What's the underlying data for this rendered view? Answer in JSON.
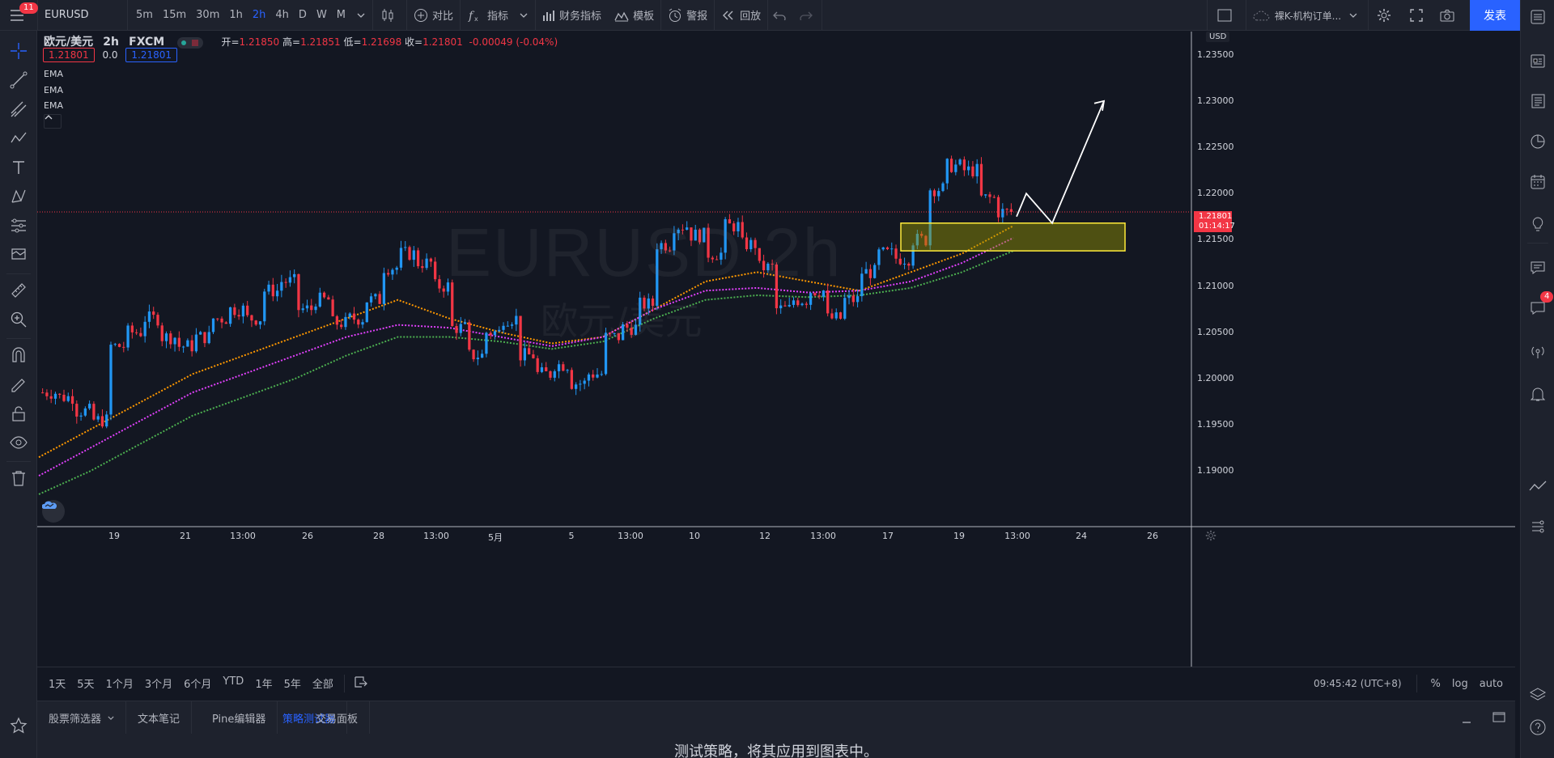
{
  "topbar": {
    "menu_badge": "11",
    "symbol": "EURUSD",
    "timeframes": [
      "5m",
      "15m",
      "30m",
      "1h",
      "2h",
      "4h",
      "D",
      "W",
      "M"
    ],
    "active_timeframe": "2h",
    "compare_label": "对比",
    "indicators_label": "指标",
    "financials_label": "财务指标",
    "templates_label": "模板",
    "alerts_label": "警报",
    "replay_label": "回放",
    "layout_name": "裸K-机构订单...",
    "publish_label": "发表"
  },
  "legend": {
    "title": "欧元/美元",
    "interval": "2h",
    "exchange": "FXCM",
    "open_label": "开=",
    "open": "1.21850",
    "high_label": "高=",
    "high": "1.21851",
    "low_label": "低=",
    "low": "1.21698",
    "close_label": "收=",
    "close": "1.21801",
    "change": "-0.00049 (-0.04%)",
    "bid": "1.21801",
    "spread": "0.0",
    "ask": "1.21801",
    "indicators": [
      "EMA",
      "EMA",
      "EMA"
    ]
  },
  "watermark": {
    "symbol": "EURUSD",
    "interval": "2h",
    "name": "欧元/美元"
  },
  "price_axis": {
    "currency": "USD",
    "ticks": [
      "1.23500",
      "1.23000",
      "1.22500",
      "1.22000",
      "1.21500",
      "1.21000",
      "1.20500",
      "1.20000",
      "1.19500",
      "1.19000"
    ],
    "current_price": "1.21801",
    "countdown": "01:14:17"
  },
  "time_axis": {
    "ticks": [
      "19",
      "21",
      "13:00",
      "26",
      "28",
      "13:00",
      "5月",
      "5",
      "13:00",
      "10",
      "12",
      "13:00",
      "17",
      "19",
      "13:00",
      "24",
      "26"
    ]
  },
  "bottom_bar": {
    "periods": [
      "1天",
      "5天",
      "1个月",
      "3个月",
      "6个月",
      "YTD",
      "1年",
      "5年",
      "全部"
    ],
    "clock": "09:45:42 (UTC+8)",
    "percent_label": "%",
    "log_label": "log",
    "auto_label": "auto"
  },
  "bottom_panel": {
    "tabs": [
      "股票筛选器",
      "文本笔记",
      "Pine编辑器",
      "策略测试器",
      "交易面板"
    ],
    "active_tab": "策略测试器",
    "message": "测试策略，将其应用到图表中。"
  },
  "right_toolbar": {
    "chat_badge": "4"
  },
  "chart_data": {
    "type": "candlestick",
    "symbol": "EURUSD",
    "interval": "2h",
    "ylim": [
      1.184,
      1.2375
    ],
    "series": [
      {
        "name": "EMA",
        "color": "#ff9800",
        "values": [
          1.1915,
          1.1945,
          1.1975,
          1.2005,
          1.2025,
          1.2045,
          1.2065,
          1.2085,
          1.2065,
          1.205,
          1.2038,
          1.2045,
          1.2075,
          1.2105,
          1.2115,
          1.2105,
          1.2095,
          1.2115,
          1.2135,
          1.2165
        ]
      },
      {
        "name": "EMA",
        "color": "#e040fb",
        "values": [
          1.1895,
          1.1925,
          1.1955,
          1.1985,
          1.2005,
          1.2025,
          1.2045,
          1.2058,
          1.2055,
          1.2045,
          1.2035,
          1.2045,
          1.2075,
          1.2095,
          1.2098,
          1.2093,
          1.2095,
          1.2105,
          1.2125,
          1.2152
        ]
      },
      {
        "name": "EMA",
        "color": "#4caf50",
        "values": [
          1.1875,
          1.19,
          1.193,
          1.196,
          1.198,
          1.2,
          1.2025,
          1.2045,
          1.2045,
          1.204,
          1.2032,
          1.204,
          1.2065,
          1.2085,
          1.209,
          1.2088,
          1.209,
          1.2098,
          1.2115,
          1.2138
        ]
      }
    ],
    "candles_close": [
      1.1985,
      1.198,
      1.1965,
      1.1955,
      1.2035,
      1.205,
      1.2065,
      1.2045,
      1.2035,
      1.2045,
      1.2065,
      1.2075,
      1.2065,
      1.2095,
      1.2105,
      1.2075,
      1.2085,
      1.206,
      1.2065,
      1.2085,
      1.212,
      1.2135,
      1.2125,
      1.21,
      1.2055,
      1.2025,
      1.205,
      1.2065,
      1.2025,
      1.2005,
      1.2015,
      1.1995,
      1.2005,
      1.2045,
      1.2055,
      1.208,
      1.2145,
      1.2165,
      1.2155,
      1.2135,
      1.2165,
      1.2145,
      1.212,
      1.2075,
      1.2085,
      1.2095,
      1.2065,
      1.2085,
      1.2115,
      1.2135,
      1.213,
      1.215,
      1.2205,
      1.223,
      1.2225,
      1.2195,
      1.218
    ],
    "zone": {
      "from": 1.2138,
      "to": 1.2168
    },
    "arrow_path": [
      1.2175,
      1.22,
      1.2168,
      1.23
    ]
  }
}
